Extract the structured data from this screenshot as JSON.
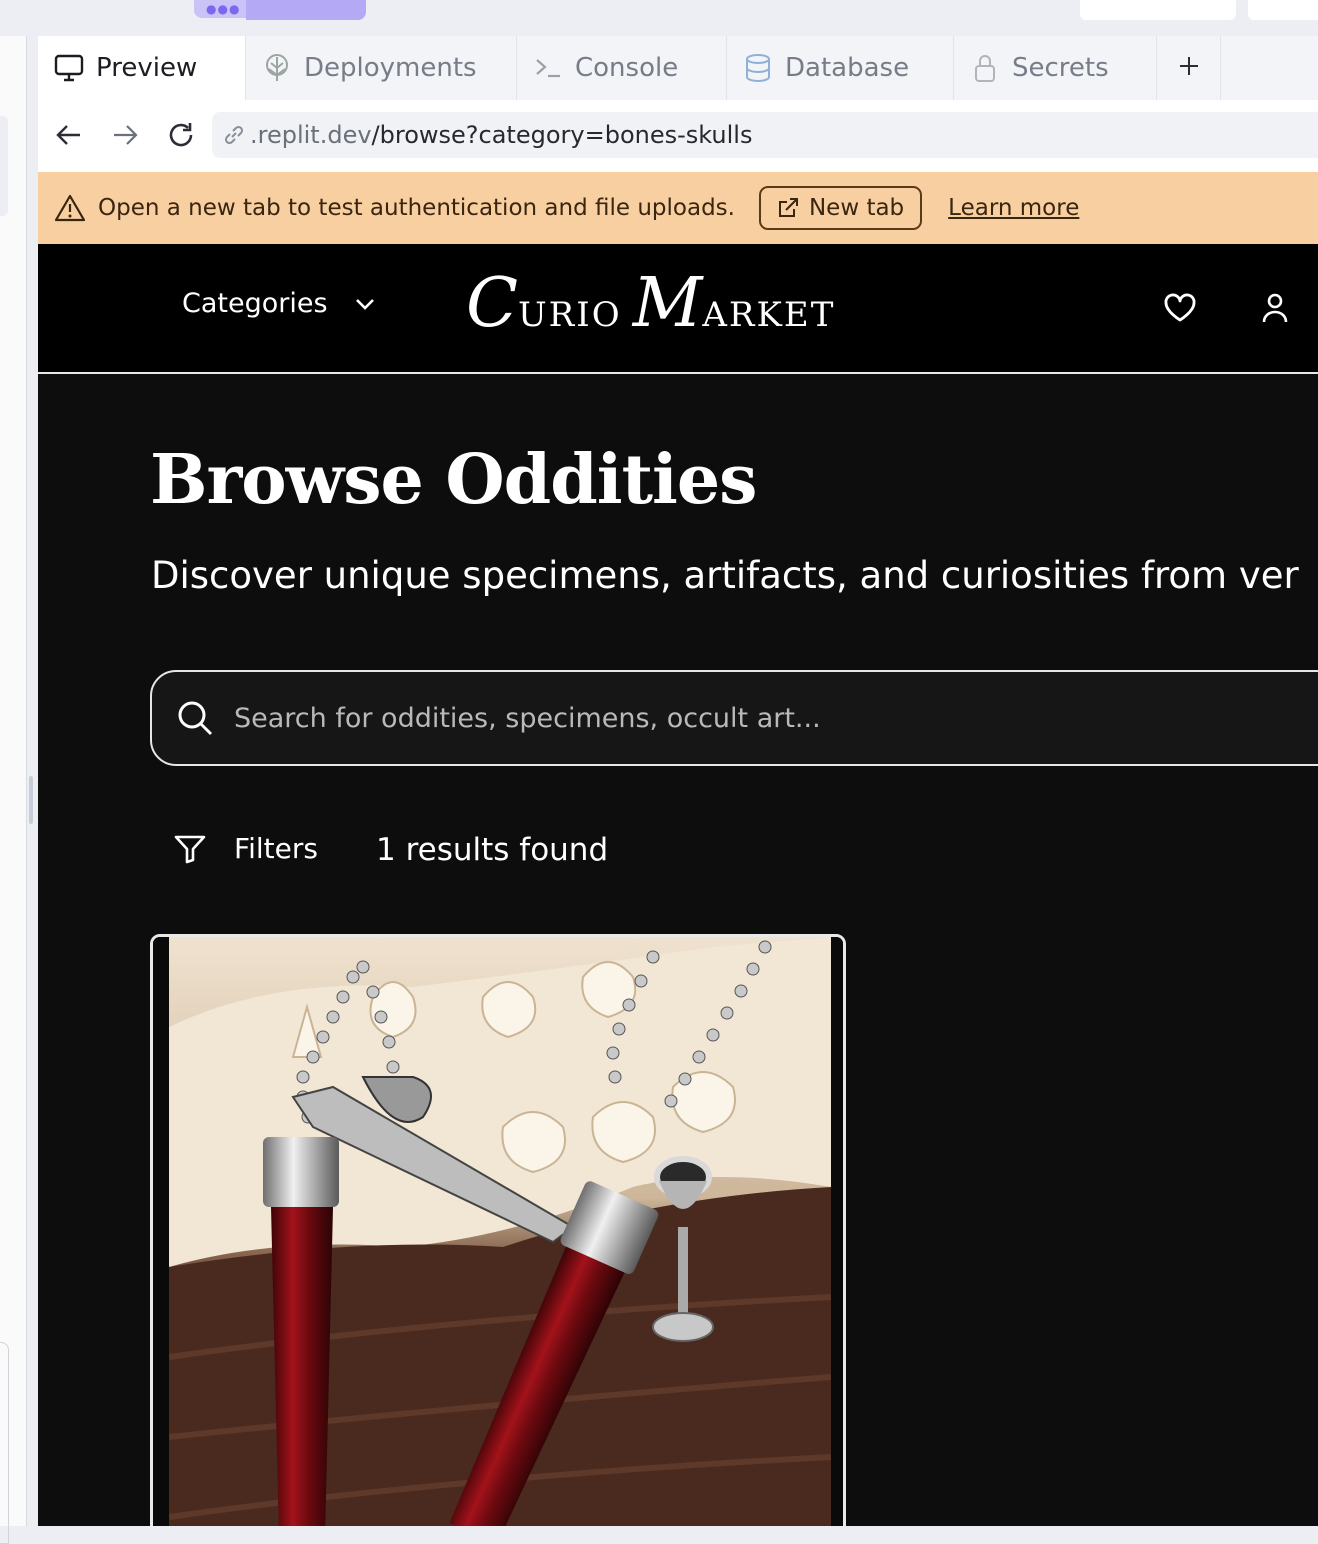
{
  "tabs": [
    {
      "label": "Preview",
      "icon": "monitor-icon",
      "active": true
    },
    {
      "label": "Deployments",
      "icon": "deployments-icon",
      "active": false
    },
    {
      "label": "Console",
      "icon": "terminal-icon",
      "active": false
    },
    {
      "label": "Database",
      "icon": "database-icon",
      "active": false
    },
    {
      "label": "Secrets",
      "icon": "lock-icon",
      "active": false
    }
  ],
  "address": {
    "domain": ".replit.dev",
    "path": "/browse?category=bones-skulls"
  },
  "banner": {
    "message": "Open a new tab to test authentication and file uploads.",
    "new_tab_label": "New tab",
    "learn_more_label": "Learn more",
    "color": "#f8cfa0"
  },
  "site": {
    "categories_label": "Categories",
    "logo": {
      "c": "C",
      "urio": "URIO",
      "m": "M",
      "arket": "ARKET"
    },
    "title": "Browse Oddities",
    "subtitle": "Discover unique specimens, artifacts, and curiosities from ver",
    "search_placeholder": "Search for oddities, specimens, occult art...",
    "filters_label": "Filters",
    "results_text": "1 results found"
  },
  "product": {
    "image_icon": "blood-vial-necklaces-image"
  }
}
